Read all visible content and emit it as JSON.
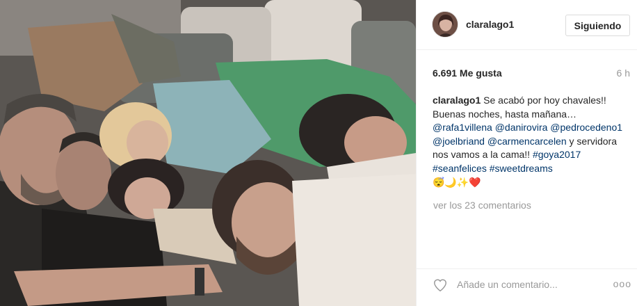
{
  "post": {
    "username": "claralago1",
    "follow_label": "Siguiendo",
    "likes": "6.691 Me gusta",
    "time": "6 h",
    "caption": {
      "user": "claralago1",
      "text1": "Se acabó por hoy chavales!! Buenas noches, hasta mañana…",
      "mentions": [
        "@rafa1villena",
        "@danirovira",
        "@pedrocedeno1",
        "@joelbriand",
        "@carmencarcelen"
      ],
      "text2": "y servidora nos vamos a la cama!!",
      "hashtags": [
        "#goya2017",
        "#seanfelices",
        "#sweetdreams"
      ],
      "emojis": "😴🌙✨❤️"
    },
    "view_comments": "ver los 23 comentarios",
    "comment_placeholder": "Añade un comentario...",
    "more_label": "ooo"
  },
  "icons": {
    "avatar": "avatar",
    "like": "heart-outline-icon",
    "more": "more-options-icon"
  },
  "colors": {
    "link": "#003569",
    "muted": "#999999",
    "border": "#efefef"
  }
}
